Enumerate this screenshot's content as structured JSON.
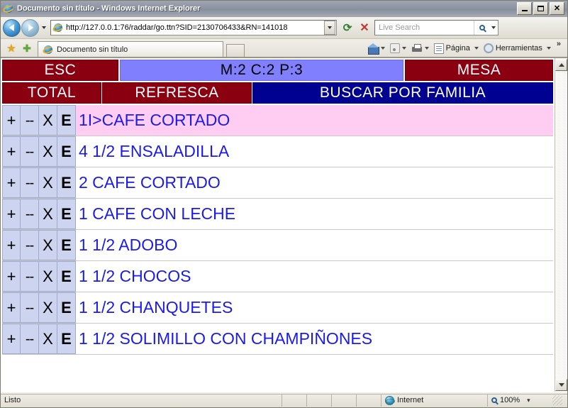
{
  "window": {
    "title": "Documento sin título - Windows Internet Explorer",
    "minimize_label": "_",
    "maximize_label": "□",
    "close_label": "✕"
  },
  "browser": {
    "url": "http://127.0.0.1:76/raddar/go.ttn?SID=2130706433&RN=141018",
    "search_placeholder": "Live Search",
    "tab_label": "Documento sin título",
    "back_icon": "back-arrow-icon",
    "forward_icon": "forward-arrow-icon",
    "refresh_icon": "refresh-icon",
    "stop_icon": "stop-icon",
    "commands": [
      {
        "label": "",
        "icon": "home-icon"
      },
      {
        "label": "",
        "icon": "rss-feeds-icon"
      },
      {
        "label": "",
        "icon": "print-icon"
      },
      {
        "label": "Página",
        "icon": "page-icon"
      },
      {
        "label": "Herramientas",
        "icon": "tools-gear-icon"
      }
    ],
    "overflow_label": "»"
  },
  "pos": {
    "top_buttons": [
      {
        "label": "ESC",
        "style": "maroon"
      },
      {
        "label": "M:2 C:2 P:3",
        "style": "periwinkle"
      },
      {
        "label": "MESA",
        "style": "maroon"
      }
    ],
    "second_buttons": [
      {
        "label": "TOTAL",
        "style": "maroon"
      },
      {
        "label": "REFRESCA",
        "style": "maroon"
      },
      {
        "label": "BUSCAR POR FAMILIA",
        "style": "navy"
      }
    ],
    "row_controls": [
      "+",
      "--",
      "X",
      "E"
    ],
    "order_lines": [
      {
        "text": "1I>CAFE CORTADO",
        "selected": true
      },
      {
        "text": "4 1/2 ENSALADILLA",
        "selected": false
      },
      {
        "text": "2 CAFE CORTADO",
        "selected": false
      },
      {
        "text": "1 CAFE CON LECHE",
        "selected": false
      },
      {
        "text": "1 1/2 ADOBO",
        "selected": false
      },
      {
        "text": "1 1/2 CHOCOS",
        "selected": false
      },
      {
        "text": "1 1/2 CHANQUETES",
        "selected": false
      },
      {
        "text": "1 1/2 SOLIMILLO CON CHAMPIÑONES",
        "selected": false
      }
    ],
    "colors": {
      "maroon": "#8b0011",
      "periwinkle": "#8080ff",
      "navy": "#000091",
      "selected_row": "#ffccf2",
      "control_button": "#ccd4f0",
      "item_text": "#1a1aee"
    }
  },
  "statusbar": {
    "status": "Listo",
    "zone": "Internet",
    "zoom": "100%",
    "zone_icon": "internet-globe-icon",
    "zoom_icon": "magnifier-icon",
    "zoom_caret": "▾"
  }
}
